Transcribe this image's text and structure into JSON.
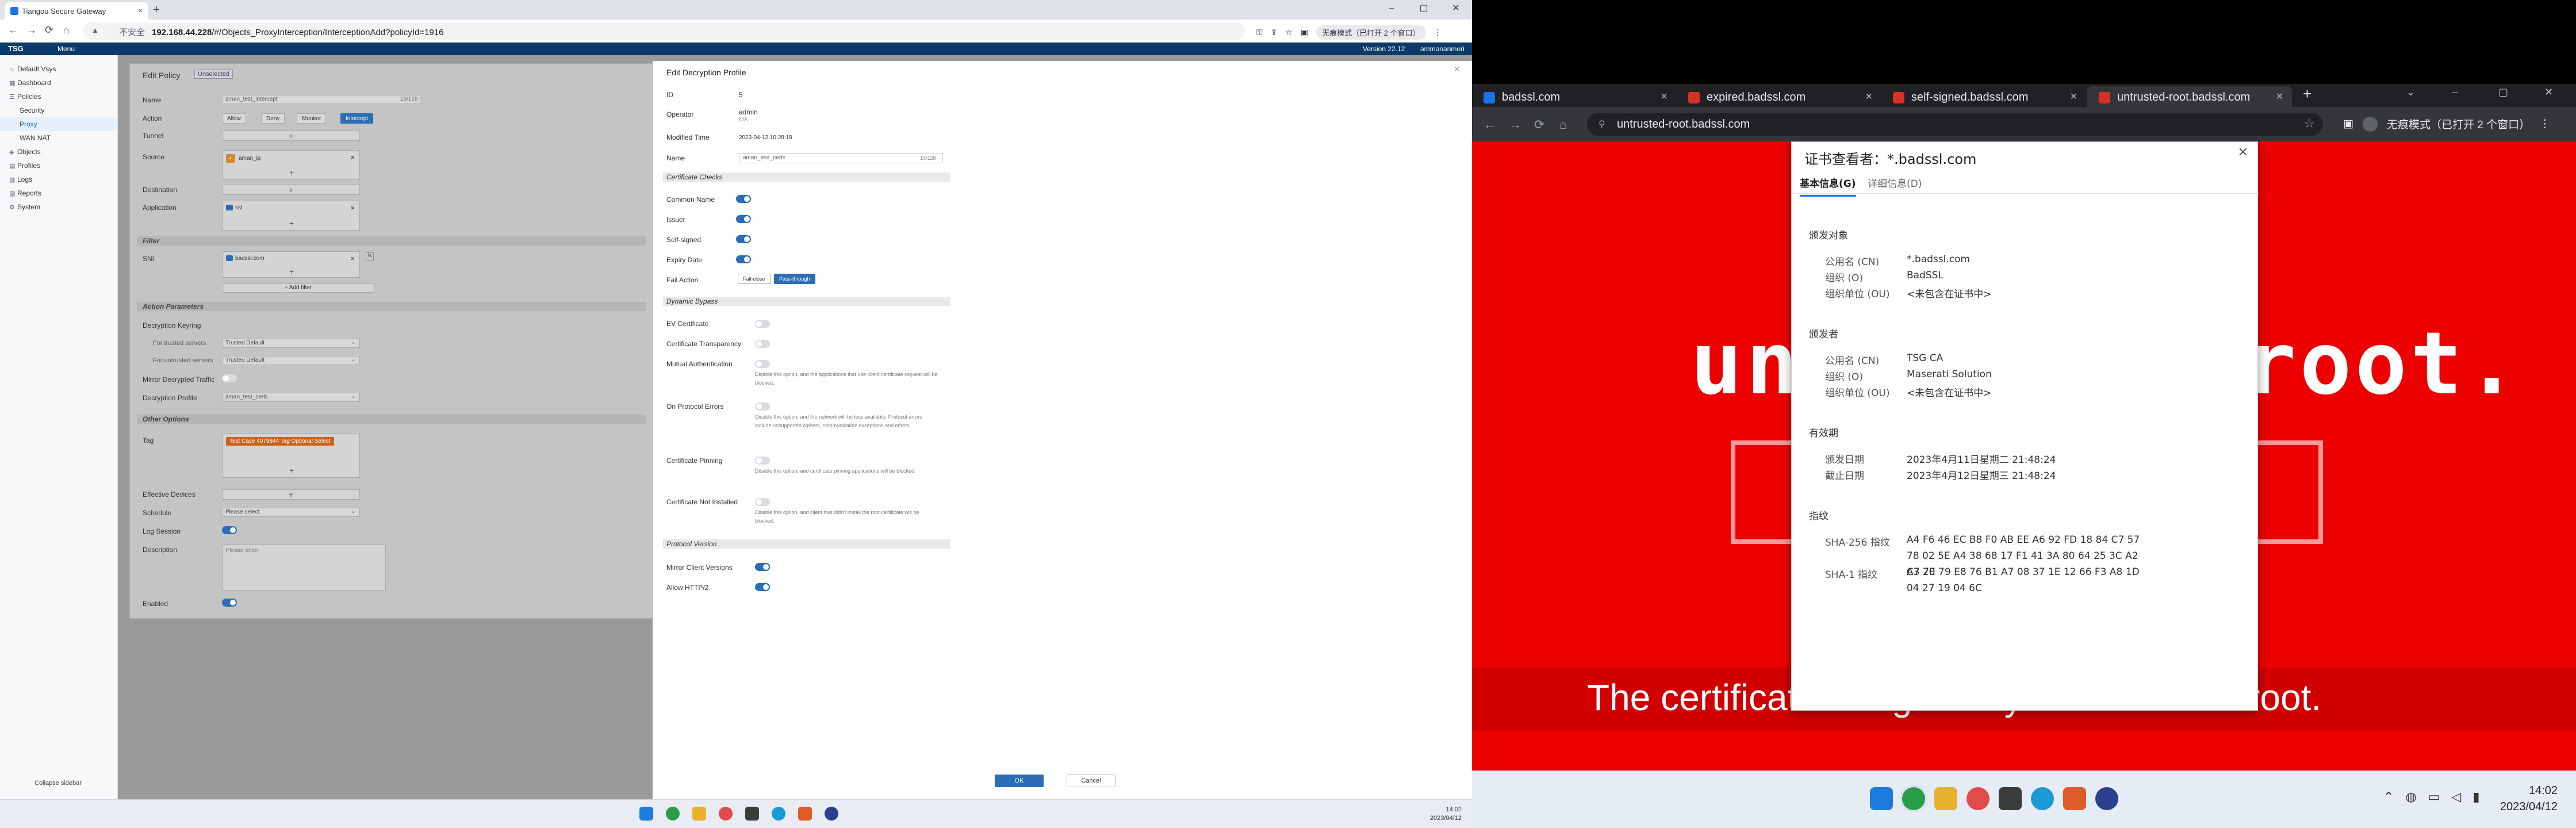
{
  "left": {
    "tab_title": "Tiangou Secure Gateway",
    "url_insecure": "不安全",
    "url_host": "192.168.44.228",
    "url_path": "/#/Objects_ProxyInterception/InterceptionAdd?policyId=1916",
    "incognito": "无痕模式（已打开 2 个窗口）",
    "tsg": {
      "logo": "TSG",
      "menu": "Menu",
      "version": "Version 22.12",
      "user": "ammananmeri"
    },
    "sidebar": {
      "items": [
        {
          "label": "Default Vsys",
          "icon": "⌂"
        },
        {
          "label": "Dashboard",
          "icon": "▦"
        },
        {
          "label": "Policies",
          "icon": "☰"
        },
        {
          "label": "Security",
          "icon": ""
        },
        {
          "label": "Proxy",
          "icon": ""
        },
        {
          "label": "WAN NAT",
          "icon": ""
        },
        {
          "label": "Objects",
          "icon": "◈"
        },
        {
          "label": "Profiles",
          "icon": "▤"
        },
        {
          "label": "Logs",
          "icon": "▥"
        },
        {
          "label": "Reports",
          "icon": "▧"
        },
        {
          "label": "System",
          "icon": "⚙"
        }
      ],
      "collapse": "Collapse sidebar"
    },
    "policy": {
      "title": "Edit Policy",
      "badge": "Unselected",
      "name_label": "Name",
      "name_value": "aman_test_intercept",
      "name_counter": "19/128",
      "action_label": "Action",
      "actions": [
        "Allow",
        "Deny",
        "Monitor",
        "Intercept"
      ],
      "tunnel_label": "Tunnel",
      "source_label": "Source",
      "source_value": "aman_ip",
      "destination_label": "Destination",
      "application_label": "Application",
      "application_value": "ssl",
      "filter_section": "Filter",
      "sni_label": "SNI",
      "sni_value": "badssl.com",
      "add_filter": "+ Add filter",
      "action_params_section": "Action Parameters",
      "decryption_keyring_label": "Decryption Keyring",
      "trusted_servers_label": "For trusted servers",
      "trusted_servers_value": "Trusted Default",
      "untrusted_servers_label": "For untrusted servers",
      "untrusted_servers_value": "Trusted Default",
      "mirror_label": "Mirror Decrypted Traffic",
      "decryption_profile_label": "Decryption Profile",
      "decryption_profile_value": "aman_test_certs",
      "other_options_section": "Other Options",
      "tag_label": "Tag",
      "tag_value": "Test Case 4079844 Tag Optional Select",
      "effective_devices_label": "Effective Devices",
      "schedule_label": "Schedule",
      "schedule_placeholder": "Please select",
      "log_session_label": "Log Session",
      "description_label": "Description",
      "description_placeholder": "Please enter",
      "enabled_label": "Enabled"
    },
    "decryption": {
      "title": "Edit Decryption Profile",
      "id_label": "ID",
      "id_value": "5",
      "operator_label": "Operator",
      "operator_value": "admin",
      "operator_sub": "N/A",
      "modified_label": "Modified Time",
      "modified_value": "2023-04-12 10:28:19",
      "name_label": "Name",
      "name_value": "aman_test_certs",
      "name_counter": "15/128",
      "cert_checks_section": "Certificate Checks",
      "common_name": "Common Name",
      "issuer": "Issuer",
      "self_signed": "Self-signed",
      "expiry_date": "Expiry Date",
      "fail_action": "Fail Action",
      "fail_close": "Fail-close",
      "pass_through": "Pass-through",
      "dynamic_bypass_section": "Dynamic Bypass",
      "ev_cert": "EV Certificate",
      "cert_transparency": "Certificate Transparency",
      "mutual_auth": "Mutual Authentication",
      "mutual_auth_help": "Disable this option, and the applications that use client certificate request will be blocked.",
      "protocol_errors": "On Protocol Errors",
      "protocol_errors_help": "Disable this option, and the network will be less available. Protocol errors include unsupported ciphers, communication exceptions and others.",
      "cert_pinning": "Certificate Pinning",
      "cert_pinning_help": "Disable this option, and certificate pinning applications will be blocked.",
      "cert_not_installed": "Certificate Not Installed",
      "cert_not_installed_help": "Disable this option, and client that didn't install the root certificate will be blocked.",
      "protocol_version_section": "Protocol Version",
      "mirror_client": "Mirror Client Versions",
      "allow_http2": "Allow HTTP/2",
      "ok": "OK",
      "cancel": "Cancel"
    },
    "taskbar_clock": {
      "time": "14:02",
      "date": "2023/04/12"
    }
  },
  "right": {
    "tabs": [
      {
        "title": "badssl.com",
        "fav": "blue"
      },
      {
        "title": "expired.badssl.com",
        "fav": "red"
      },
      {
        "title": "self-signed.badssl.com",
        "fav": "red"
      },
      {
        "title": "untrusted-root.badssl.com",
        "fav": "red"
      }
    ],
    "url": "untrusted-root.badssl.com",
    "incognito": "无痕模式（已打开 2 个窗口）",
    "page_big": "untrusted-root.",
    "page_bottom": "The certificate is signed by an untrusted root.",
    "cert": {
      "title": "证书查看者：*.badssl.com",
      "tab_basic": "基本信息(G)",
      "tab_details": "详细信息(D)",
      "issued_to": "颁发对象",
      "cn_label": "公用名 (CN)",
      "o_label": "组织 (O)",
      "ou_label": "组织单位 (OU)",
      "to_cn": "*.badssl.com",
      "to_o": "BadSSL",
      "to_ou": "<未包含在证书中>",
      "issued_by": "颁发者",
      "by_cn": "TSG CA",
      "by_o": "Maserati Solution",
      "by_ou": "<未包含在证书中>",
      "validity": "有效期",
      "issue_date_label": "颁发日期",
      "issue_date": "2023年4月11日星期二 21:48:24",
      "expiry_date_label": "截止日期",
      "expiry_date": "2023年4月12日星期三 21:48:24",
      "fingerprints": "指纹",
      "sha256_label": "SHA-256 指纹",
      "sha256": "A4 F6 46 EC B8 F0 AB EE A6 92 FD 18 84 C7 57 78 02 5E A4 38 68 17 F1 41 3A 80 64 25 3C A2 A3 20",
      "sha1_label": "SHA-1 指纹",
      "sha1": "C7 7E 79 E8 76 B1 A7 08 37 1E 12 66 F3 A8 1D 04 27 19 04 6C"
    },
    "taskbar_clock": {
      "time": "14:02",
      "date": "2023/04/12"
    }
  }
}
